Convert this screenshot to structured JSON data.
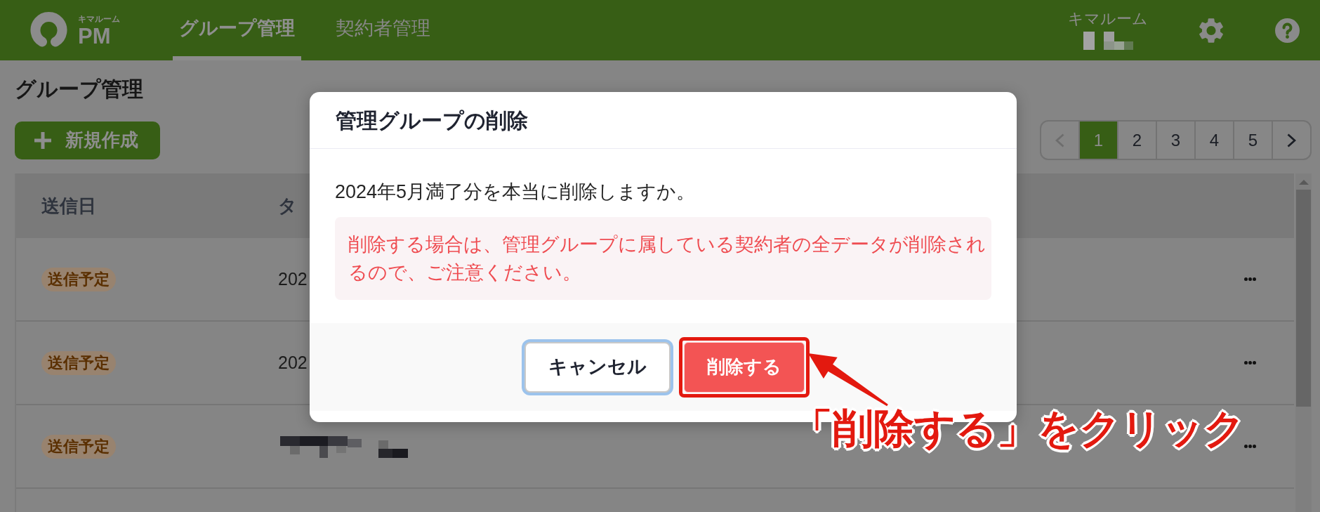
{
  "header": {
    "logo": {
      "tagline": "キマルーム",
      "wordmark": "PM"
    },
    "tabs": [
      {
        "label": "グループ管理",
        "selected": true
      },
      {
        "label": "契約者管理",
        "selected": false
      }
    ],
    "account": {
      "organization": "キマルーム"
    }
  },
  "page": {
    "title": "グループ管理",
    "create_button": "新規作成"
  },
  "pagination": {
    "previous": {
      "disabled": true
    },
    "pages": [
      {
        "label": "1",
        "selected": true
      },
      {
        "label": "2",
        "selected": false
      },
      {
        "label": "3",
        "selected": false
      },
      {
        "label": "4",
        "selected": false
      },
      {
        "label": "5",
        "selected": false
      }
    ],
    "next": {
      "disabled": false
    }
  },
  "table": {
    "columns": [
      "送信日",
      "タ"
    ],
    "rows": [
      {
        "kind": "text",
        "status": "送信予定",
        "column_2": "202"
      },
      {
        "kind": "text",
        "status": "送信予定",
        "column_2": "202"
      },
      {
        "kind": "redacted",
        "status": "送信予定"
      }
    ]
  },
  "modal": {
    "title": "管理グループの削除",
    "message": "2024年5月満了分を本当に削除しますか。",
    "warning": "削除する場合は、管理グループに属している契約者の全データが削除されるので、ご注意ください。",
    "buttons": [
      {
        "kind": "secondary",
        "label": "キャンセル",
        "focused": true,
        "highlighted": false
      },
      {
        "kind": "danger",
        "label": "削除する",
        "focused": false,
        "highlighted": true
      }
    ]
  },
  "annotation": {
    "callout": "「削除する」をクリック"
  }
}
